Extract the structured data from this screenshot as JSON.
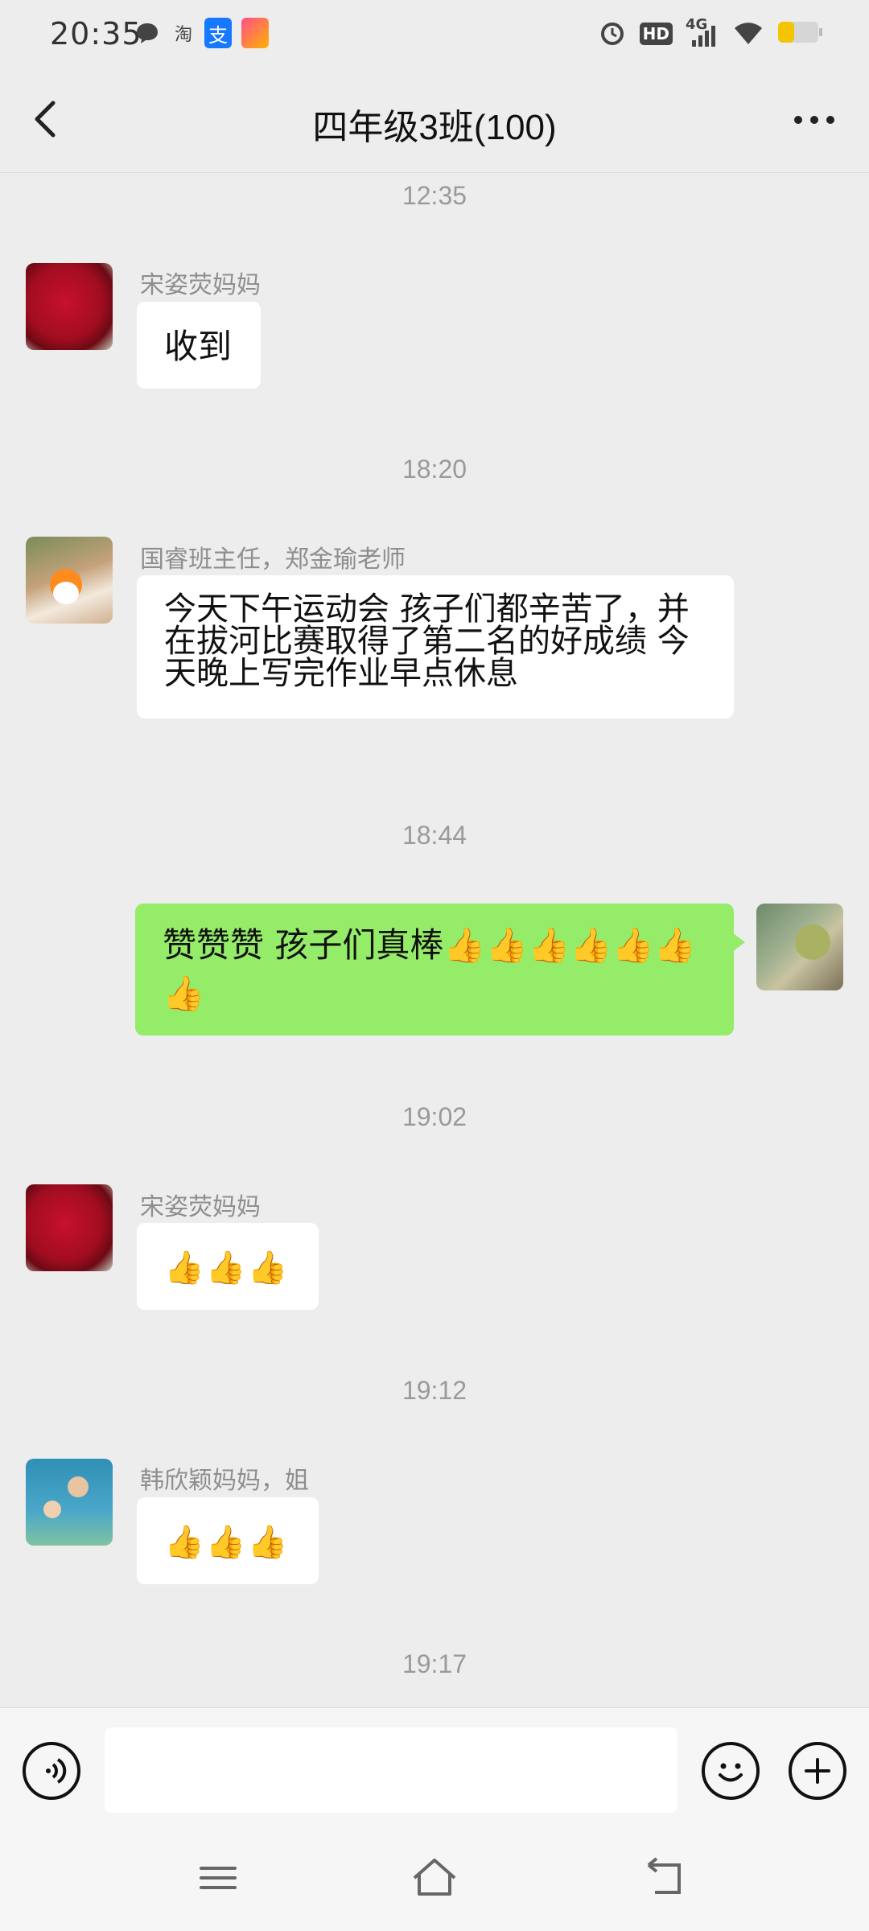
{
  "status_bar": {
    "time": "20:35",
    "icons_left": [
      "message-icon",
      "taobao-icon",
      "alipay-icon",
      "app-icon"
    ],
    "icons_right": [
      "alarm-icon",
      "hd-icon",
      "4g-signal-icon",
      "wifi-icon",
      "battery-icon"
    ],
    "hd": "HD",
    "net": "4G",
    "taobao": "淘",
    "alipay": "支"
  },
  "header": {
    "title": "四年级3班(100)"
  },
  "messages": [
    {
      "timestamp": "12:35",
      "sender": "宋姿荧妈妈",
      "text": "收到",
      "side": "left"
    },
    {
      "timestamp": "18:20",
      "sender": "国睿班主任，郑金瑜老师",
      "text": "今天下午运动会  孩子们都辛苦了，并在拔河比赛取得了第二名的好成绩   今天晚上写完作业早点休息",
      "side": "left"
    },
    {
      "timestamp": "18:44",
      "sender": "",
      "text": "赞赞赞 孩子们真棒👍👍👍👍👍👍👍",
      "side": "right"
    },
    {
      "timestamp": "19:02",
      "sender": "宋姿荧妈妈",
      "text": "👍👍👍",
      "side": "left"
    },
    {
      "timestamp": "19:12",
      "sender": "韩欣颖妈妈，姐",
      "text": "👍👍👍",
      "side": "left"
    },
    {
      "timestamp": "19:17"
    }
  ],
  "input": {
    "value": "",
    "placeholder": ""
  },
  "colors": {
    "background": "#ededed",
    "bubble_self": "#95ec69",
    "bubble_other": "#ffffff",
    "battery": "#f5c400"
  }
}
